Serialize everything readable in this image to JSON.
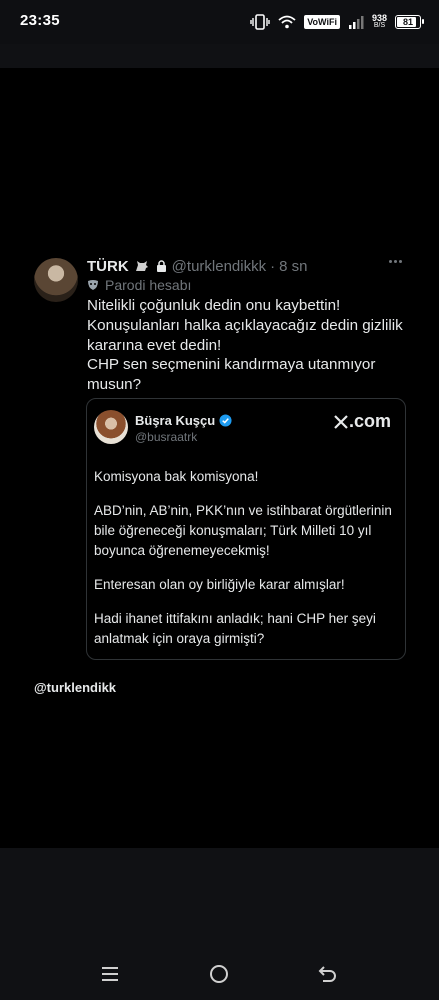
{
  "status_bar": {
    "time": "23:35",
    "network_label": "VoWiFi",
    "net_speed": "938",
    "net_speed_unit": "B/S",
    "battery": "81"
  },
  "tweet": {
    "name": "TÜRK",
    "handle": "@turklendikkk",
    "separator": "·",
    "time_ago": "8 sn",
    "label": "Parodi hesabı",
    "text": "Nitelikli çoğunluk dedin onu kaybettin!\nKonuşulanları halka açıklayacağız dedin gizlilik kararına evet dedin!\nCHP sen seçmenini kandırmaya utanmıyor musun?"
  },
  "quote": {
    "name": "Büşra Kuşçu",
    "handle": "@busraatrk",
    "brand": ".com",
    "paragraphs": [
      "Komisyona bak komisyona!",
      "ABD’nin, AB’nin, PKK’nın ve istihbarat örgütlerinin bile öğreneceği konuşmaları; Türk Milleti 10 yıl boyunca öğrenemeyecekmiş!",
      "Enteresan olan oy birliğiyle karar almışlar!",
      "Hadi ihanet ittifakını anladık; hani CHP her şeyi anlatmak için oraya girmişti?"
    ]
  },
  "caption": "@turklendikk",
  "icons": {
    "status": [
      "vibrate-icon",
      "wifi-icon",
      "signal-icon",
      "battery-icon"
    ],
    "tweet": [
      "goat-icon",
      "lock-icon",
      "more-icon",
      "mask-icon",
      "verified-icon",
      "x-logo-icon"
    ],
    "nav": [
      "menu-icon",
      "home-icon",
      "back-icon"
    ]
  },
  "colors": {
    "background": "#000000",
    "text": "#e7e9ea",
    "muted": "#71767b",
    "verified": "#1d9bf0",
    "border": "#2f3336"
  }
}
